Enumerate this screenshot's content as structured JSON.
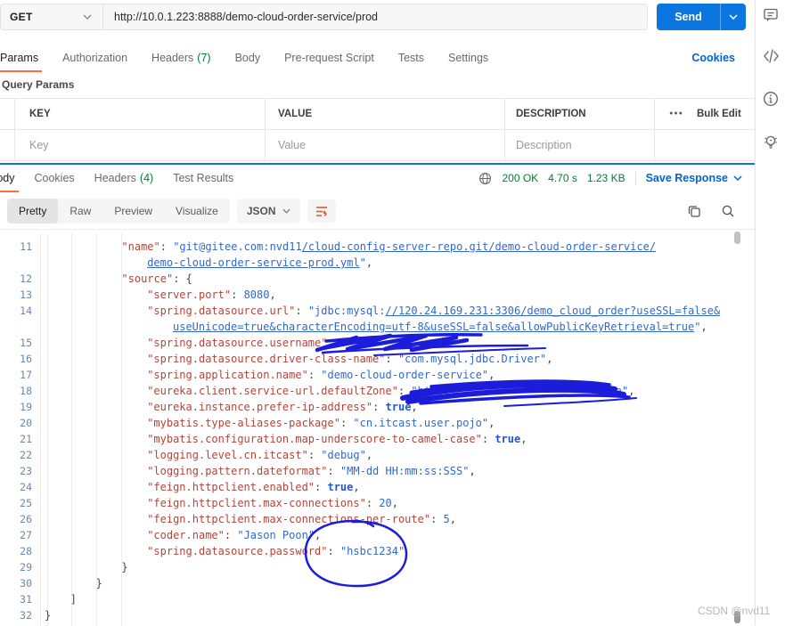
{
  "colors": {
    "send": "#0b76e0",
    "link": "#0265d2",
    "orange": "#ff6c37",
    "green": "#007f31",
    "ink": "#1c1cdb",
    "key": "#b0463c",
    "str": "#3568c4",
    "bool": "#2257d2",
    "num": "#3568c4"
  },
  "request": {
    "method": "GET",
    "url": "http://10.0.1.223:8888/demo-cloud-order-service/prod",
    "send_label": "Send",
    "cookies_link": "Cookies",
    "tabs": [
      {
        "label": "Params"
      },
      {
        "label": "Authorization"
      },
      {
        "label": "Headers",
        "count": "(7)"
      },
      {
        "label": "Body"
      },
      {
        "label": "Pre-request Script"
      },
      {
        "label": "Tests"
      },
      {
        "label": "Settings"
      }
    ]
  },
  "params": {
    "section_title": "Query Params",
    "columns": {
      "key": "KEY",
      "value": "VALUE",
      "description": "DESCRIPTION"
    },
    "placeholders": {
      "key": "Key",
      "value": "Value",
      "description": "Description"
    },
    "more_icon": "●●●",
    "bulk_edit": "Bulk Edit"
  },
  "response": {
    "tabs": [
      {
        "label": "Body"
      },
      {
        "label": "Cookies"
      },
      {
        "label": "Headers",
        "count": "(4)"
      },
      {
        "label": "Test Results"
      }
    ],
    "status": "200 OK",
    "time": "4.70 s",
    "size": "1.23 KB",
    "save_label": "Save Response",
    "view_tabs": [
      {
        "label": "Pretty"
      },
      {
        "label": "Raw"
      },
      {
        "label": "Preview"
      },
      {
        "label": "Visualize"
      }
    ],
    "format": "JSON"
  },
  "code": {
    "lines": [
      {
        "num": "11",
        "indent": 12,
        "segs": [
          {
            "t": "k",
            "v": "\"name\""
          },
          {
            "t": "p",
            "v": ": "
          },
          {
            "t": "s",
            "v": "\"git@gitee.com:nvd11"
          },
          {
            "t": "l",
            "v": "/cloud-config-server-repo.git/demo-cloud-order-service/"
          }
        ]
      },
      {
        "num": "",
        "indent": 16,
        "segs": [
          {
            "t": "l",
            "v": "demo-cloud-order-service-prod.yml"
          },
          {
            "t": "s",
            "v": "\""
          },
          {
            "t": "p",
            "v": ","
          }
        ]
      },
      {
        "num": "12",
        "indent": 12,
        "segs": [
          {
            "t": "k",
            "v": "\"source\""
          },
          {
            "t": "p",
            "v": ": {"
          }
        ]
      },
      {
        "num": "13",
        "indent": 16,
        "segs": [
          {
            "t": "k",
            "v": "\"server.port\""
          },
          {
            "t": "p",
            "v": ": "
          },
          {
            "t": "n",
            "v": "8080"
          },
          {
            "t": "p",
            "v": ","
          }
        ]
      },
      {
        "num": "14",
        "indent": 16,
        "segs": [
          {
            "t": "k",
            "v": "\"spring.datasource.url\""
          },
          {
            "t": "p",
            "v": ": "
          },
          {
            "t": "s",
            "v": "\"jdbc:mysql:"
          },
          {
            "t": "l",
            "v": "//120.24.169.231:3306/demo_cloud_order?useSSL=false&"
          }
        ]
      },
      {
        "num": "",
        "indent": 20,
        "segs": [
          {
            "t": "l",
            "v": "useUnicode=true&characterEncoding=utf-8&useSSL=false&allowPublicKeyRetrieval=true"
          },
          {
            "t": "s",
            "v": "\""
          },
          {
            "t": "p",
            "v": ","
          }
        ]
      },
      {
        "num": "15",
        "indent": 16,
        "segs": [
          {
            "t": "k",
            "v": "\"spring.datasource.username\""
          },
          {
            "t": "p",
            "v": ": "
          }
        ]
      },
      {
        "num": "16",
        "indent": 16,
        "segs": [
          {
            "t": "k",
            "v": "\"spring.datasource.driver-class-name\""
          },
          {
            "t": "p",
            "v": ": "
          },
          {
            "t": "s",
            "v": "\"com.mysql.jdbc.Driver\""
          },
          {
            "t": "p",
            "v": ","
          }
        ]
      },
      {
        "num": "17",
        "indent": 16,
        "segs": [
          {
            "t": "k",
            "v": "\"spring.application.name\""
          },
          {
            "t": "p",
            "v": ": "
          },
          {
            "t": "s",
            "v": "\"demo-cloud-order-service\""
          },
          {
            "t": "p",
            "v": ","
          }
        ]
      },
      {
        "num": "18",
        "indent": 16,
        "segs": [
          {
            "t": "k",
            "v": "\"eureka.client.service-url.defaultZone\""
          },
          {
            "t": "p",
            "v": ": "
          },
          {
            "t": "s",
            "v": "\"http:"
          },
          {
            "t": "gap",
            "w": 186
          },
          {
            "t": "s",
            "v": "a\""
          },
          {
            "t": "p",
            "v": ","
          }
        ]
      },
      {
        "num": "19",
        "indent": 16,
        "segs": [
          {
            "t": "k",
            "v": "\"eureka.instance.prefer-ip-address\""
          },
          {
            "t": "p",
            "v": ": "
          },
          {
            "t": "b",
            "v": "true"
          },
          {
            "t": "p",
            "v": ","
          }
        ]
      },
      {
        "num": "20",
        "indent": 16,
        "segs": [
          {
            "t": "k",
            "v": "\"mybatis.type-aliases-package\""
          },
          {
            "t": "p",
            "v": ": "
          },
          {
            "t": "s",
            "v": "\"cn.itcast.user.pojo\""
          },
          {
            "t": "p",
            "v": ","
          }
        ]
      },
      {
        "num": "21",
        "indent": 16,
        "segs": [
          {
            "t": "k",
            "v": "\"mybatis.configuration.map-underscore-to-camel-case\""
          },
          {
            "t": "p",
            "v": ": "
          },
          {
            "t": "b",
            "v": "true"
          },
          {
            "t": "p",
            "v": ","
          }
        ]
      },
      {
        "num": "22",
        "indent": 16,
        "segs": [
          {
            "t": "k",
            "v": "\"logging.level.cn.itcast\""
          },
          {
            "t": "p",
            "v": ": "
          },
          {
            "t": "s",
            "v": "\"debug\""
          },
          {
            "t": "p",
            "v": ","
          }
        ]
      },
      {
        "num": "23",
        "indent": 16,
        "segs": [
          {
            "t": "k",
            "v": "\"logging.pattern.dateformat\""
          },
          {
            "t": "p",
            "v": ": "
          },
          {
            "t": "s",
            "v": "\"MM-dd HH:mm:ss:SSS\""
          },
          {
            "t": "p",
            "v": ","
          }
        ]
      },
      {
        "num": "24",
        "indent": 16,
        "segs": [
          {
            "t": "k",
            "v": "\"feign.httpclient.enabled\""
          },
          {
            "t": "p",
            "v": ": "
          },
          {
            "t": "b",
            "v": "true"
          },
          {
            "t": "p",
            "v": ","
          }
        ]
      },
      {
        "num": "25",
        "indent": 16,
        "segs": [
          {
            "t": "k",
            "v": "\"feign.httpclient.max-connections\""
          },
          {
            "t": "p",
            "v": ": "
          },
          {
            "t": "n",
            "v": "20"
          },
          {
            "t": "p",
            "v": ","
          }
        ]
      },
      {
        "num": "26",
        "indent": 16,
        "segs": [
          {
            "t": "k",
            "v": "\"feign.httpclient.max-connections-per-route\""
          },
          {
            "t": "p",
            "v": ": "
          },
          {
            "t": "n",
            "v": "5"
          },
          {
            "t": "p",
            "v": ","
          }
        ]
      },
      {
        "num": "27",
        "indent": 16,
        "segs": [
          {
            "t": "k",
            "v": "\"coder.name\""
          },
          {
            "t": "p",
            "v": ": "
          },
          {
            "t": "s",
            "v": "\"Jason Poon\""
          },
          {
            "t": "p",
            "v": ","
          }
        ]
      },
      {
        "num": "28",
        "indent": 16,
        "segs": [
          {
            "t": "k",
            "v": "\"spring.datasource.password\""
          },
          {
            "t": "p",
            "v": ": "
          },
          {
            "t": "s",
            "v": "\"hsbc1234\""
          }
        ]
      },
      {
        "num": "29",
        "indent": 12,
        "segs": [
          {
            "t": "p",
            "v": "}"
          }
        ]
      },
      {
        "num": "30",
        "indent": 8,
        "segs": [
          {
            "t": "p",
            "v": "}"
          }
        ]
      },
      {
        "num": "31",
        "indent": 4,
        "segs": [
          {
            "t": "p",
            "v": "]"
          }
        ]
      },
      {
        "num": "32",
        "indent": 0,
        "segs": [
          {
            "t": "p",
            "v": "}"
          }
        ]
      }
    ]
  },
  "watermark": "CSDN @nvd11"
}
